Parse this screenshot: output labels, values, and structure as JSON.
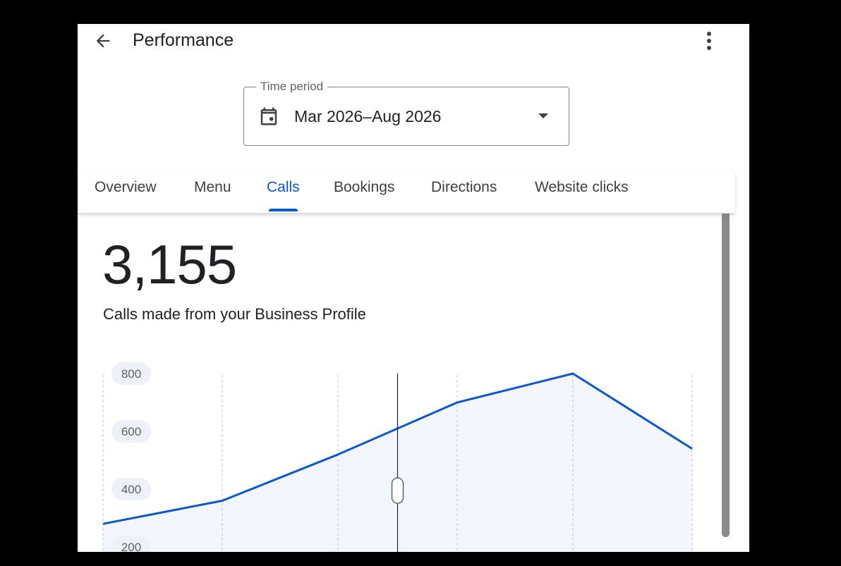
{
  "header": {
    "title": "Performance",
    "back_icon": "arrow-left-icon",
    "more_icon": "more-vert-icon"
  },
  "time_period": {
    "label": "Time period",
    "value": "Mar 2026–Aug 2026",
    "icon": "calendar-icon",
    "dropdown_icon": "arrow-drop-down-icon"
  },
  "tabs": [
    {
      "label": "Overview",
      "active": false
    },
    {
      "label": "Menu",
      "active": false
    },
    {
      "label": "Calls",
      "active": true
    },
    {
      "label": "Bookings",
      "active": false
    },
    {
      "label": "Directions",
      "active": false
    },
    {
      "label": "Website clicks",
      "active": false
    }
  ],
  "summary": {
    "total": "3,155",
    "description": "Calls made from your Business Profile"
  },
  "colors": {
    "accent": "#0b57d0",
    "area_fill": "#f3f6fc",
    "text": "#202124"
  },
  "chart_data": {
    "type": "area",
    "x": [
      0,
      1,
      2,
      3,
      4,
      5
    ],
    "values": [
      280,
      360,
      520,
      700,
      800,
      540
    ],
    "ylim": [
      200,
      800
    ],
    "yticks": [
      "800",
      "600",
      "400",
      "200"
    ],
    "grid": "vertical dashed",
    "cursor_at": 2.5
  }
}
